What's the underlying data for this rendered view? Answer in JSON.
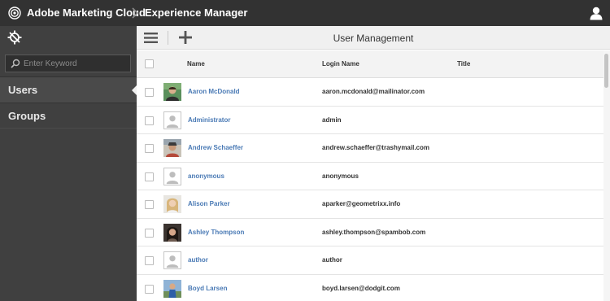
{
  "topbar": {
    "brand": "Adobe Marketing Cloud",
    "product": "Experience Manager"
  },
  "rail": {
    "search_placeholder": "Enter Keyword",
    "items": [
      {
        "label": "Users",
        "active": true
      },
      {
        "label": "Groups",
        "active": false
      }
    ]
  },
  "toolbar": {
    "title": "User Management"
  },
  "table": {
    "columns": [
      "Name",
      "Login Name",
      "Title"
    ],
    "rows": [
      {
        "name": "Aaron McDonald",
        "login": "aaron.mcdonald@mailinator.com",
        "title": "",
        "avatar": "photo"
      },
      {
        "name": "Administrator",
        "login": "admin",
        "title": "",
        "avatar": "generic"
      },
      {
        "name": "Andrew Schaeffer",
        "login": "andrew.schaeffer@trashymail.com",
        "title": "",
        "avatar": "photo"
      },
      {
        "name": "anonymous",
        "login": "anonymous",
        "title": "",
        "avatar": "generic"
      },
      {
        "name": "Alison Parker",
        "login": "aparker@geometrixx.info",
        "title": "",
        "avatar": "photo"
      },
      {
        "name": "Ashley Thompson",
        "login": "ashley.thompson@spambob.com",
        "title": "",
        "avatar": "photo"
      },
      {
        "name": "author",
        "login": "author",
        "title": "",
        "avatar": "generic"
      },
      {
        "name": "Boyd Larsen",
        "login": "boyd.larsen@dodgit.com",
        "title": "",
        "avatar": "photo"
      }
    ]
  },
  "colors": {
    "topbar": "#323232",
    "rail": "#404040",
    "link": "#4a7ab5"
  }
}
